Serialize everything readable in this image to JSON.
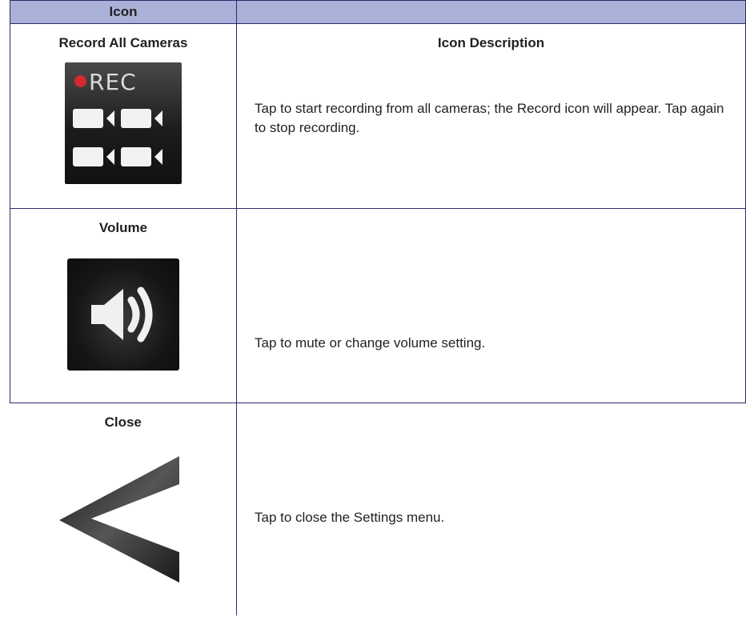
{
  "table": {
    "header": {
      "col1": "Icon",
      "col2": ""
    },
    "rows": [
      {
        "icon_name": "Record All Cameras",
        "desc_title": "Icon Description",
        "icon_text": "REC",
        "description": "Tap to start recording from all cameras; the Record icon will appear. Tap again to stop recording.",
        "icon": "record-all-cameras-icon"
      },
      {
        "icon_name": "Volume",
        "description": "Tap to mute or change volume setting.",
        "icon": "volume-icon"
      },
      {
        "icon_name": "Close",
        "description": "Tap to close the Settings menu.",
        "icon": "close-chevron-icon"
      }
    ]
  },
  "colors": {
    "header_bg": "#a9b1d8",
    "border": "#2b2b6b",
    "rec_dot": "#d42a2f"
  }
}
